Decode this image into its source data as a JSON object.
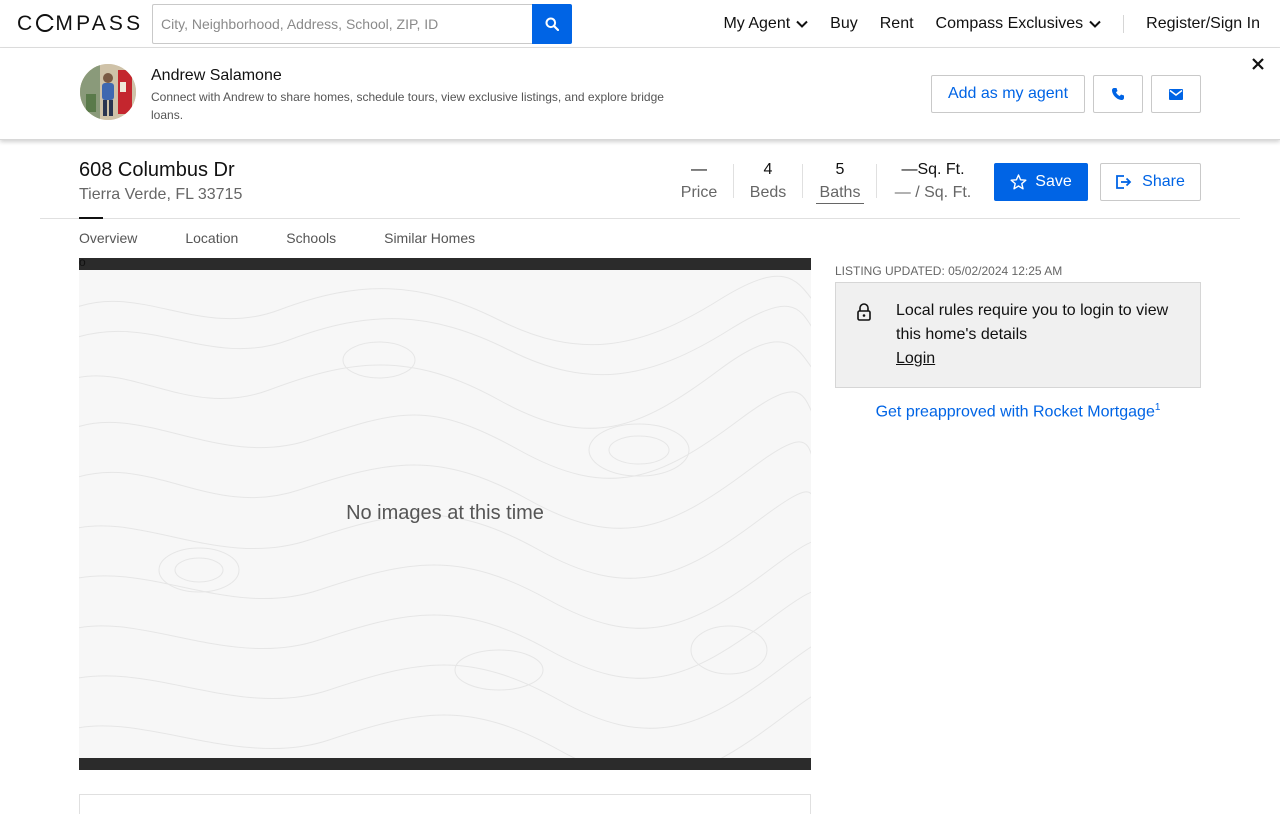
{
  "nav": {
    "logo": "COMPASS",
    "search_placeholder": "City, Neighborhood, Address, School, ZIP, ID",
    "links": [
      "My Agent",
      "Buy",
      "Rent",
      "Compass Exclusives",
      "Register/Sign In"
    ]
  },
  "agent": {
    "name": "Andrew Salamone",
    "description": "Connect with Andrew to share homes, schedule tours, view exclusive listings, and explore bridge loans.",
    "add_label": "Add as my agent"
  },
  "listing": {
    "address": "608 Columbus Dr",
    "city": "Tierra Verde, FL 33715",
    "price_value": "—",
    "price_label": "Price",
    "beds_value": "4",
    "beds_label": "Beds",
    "baths_value": "5",
    "baths_label": "Baths",
    "sqft_value": "—Sq. Ft.",
    "sqft_label": "— / Sq. Ft.",
    "save_label": "Save",
    "share_label": "Share"
  },
  "tabs": [
    "Overview",
    "Location",
    "Schools",
    "Similar Homes"
  ],
  "gallery": {
    "corner_glyph": "o",
    "no_images": "No images at this time"
  },
  "sidebar": {
    "updated": "LISTING UPDATED: 05/02/2024 12:25 AM",
    "login_message": "Local rules require you to login to view this home's details",
    "login_link": "Login",
    "preapproved": "Get preapproved with Rocket Mortgage",
    "preapproved_sup": "1"
  },
  "colors": {
    "accent": "#0064e5",
    "panel_bg": "#f0f0f0",
    "gallery_frame": "#2b2b2b"
  }
}
